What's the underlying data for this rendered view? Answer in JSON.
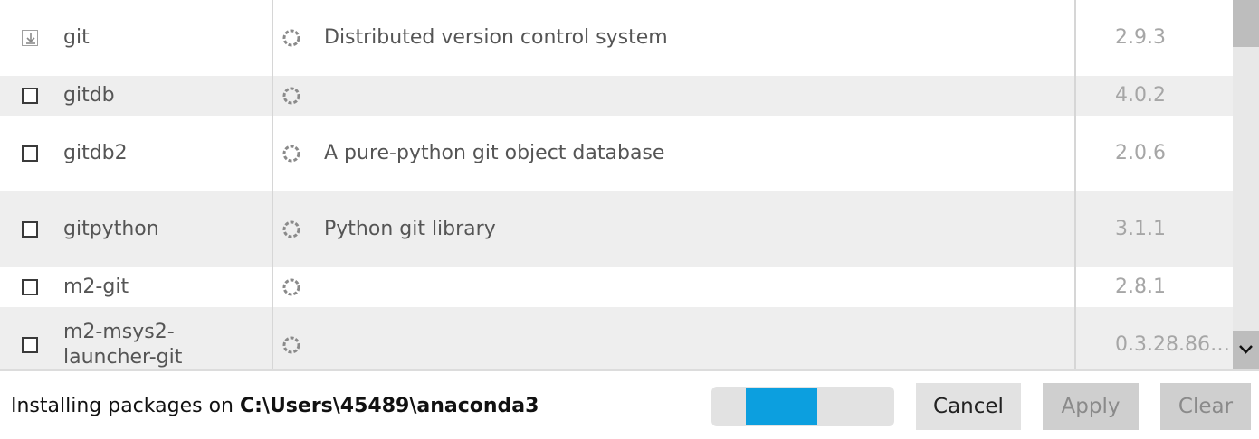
{
  "packages": [
    {
      "name": "git",
      "description": "Distributed version control system",
      "version": "2.9.3",
      "installed": true
    },
    {
      "name": "gitdb",
      "description": "",
      "version": "4.0.2",
      "installed": false
    },
    {
      "name": "gitdb2",
      "description": "A pure-python git object database",
      "version": "2.0.6",
      "installed": false
    },
    {
      "name": "gitpython",
      "description": "Python git library",
      "version": "3.1.1",
      "installed": false
    },
    {
      "name": "m2-git",
      "description": "",
      "version": "2.8.1",
      "installed": false
    },
    {
      "name": "m2-msys2-launcher-git",
      "description": "",
      "version": "0.3.28.86…",
      "installed": false
    }
  ],
  "status": {
    "prefix": "Installing packages on ",
    "path": "C:\\Users\\45489\\anaconda3"
  },
  "progress": {
    "fill_start": 0.19,
    "fill_end": 0.58,
    "color": "#0c9fdf"
  },
  "buttons": {
    "cancel": "Cancel",
    "apply": "Apply",
    "clear": "Clear"
  },
  "colors": {
    "row_alt": "#eeeeee",
    "text": "#555555",
    "version_text": "#a6a6a6",
    "disabled_button": "#cfcfcf"
  },
  "icons": {
    "installed": "installed-checkbox-icon",
    "status": "loading-spinner-icon",
    "scroll_down": "chevron-down-icon"
  }
}
